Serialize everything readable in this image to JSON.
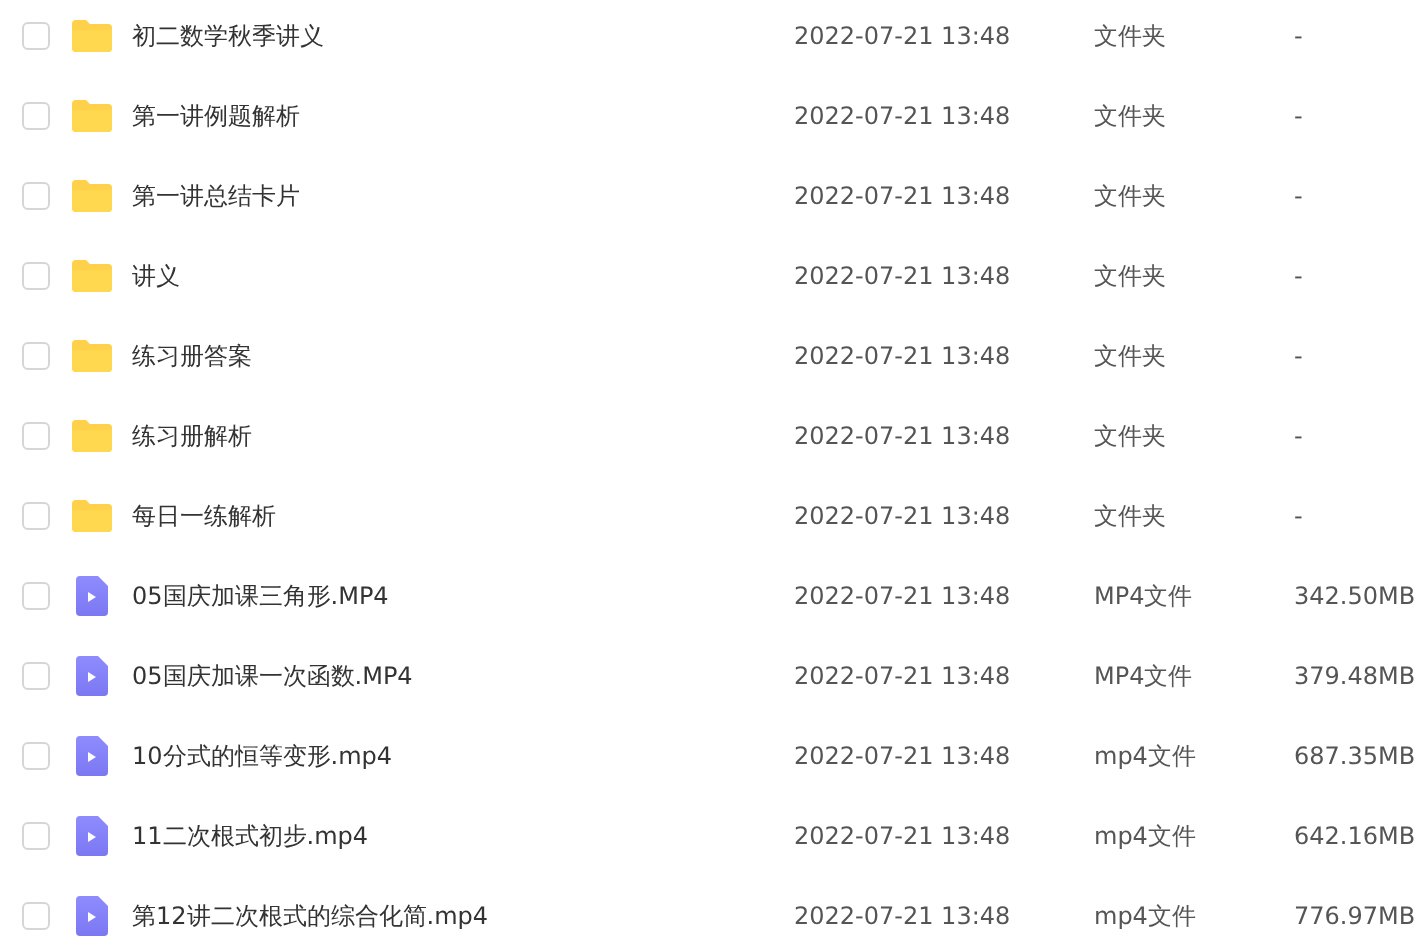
{
  "files": [
    {
      "kind": "folder",
      "checked": false,
      "name": "初二数学秋季讲义",
      "modified": "2022-07-21 13:48",
      "type": "文件夹",
      "size": "-"
    },
    {
      "kind": "folder",
      "checked": false,
      "name": "第一讲例题解析",
      "modified": "2022-07-21 13:48",
      "type": "文件夹",
      "size": "-"
    },
    {
      "kind": "folder",
      "checked": false,
      "name": "第一讲总结卡片",
      "modified": "2022-07-21 13:48",
      "type": "文件夹",
      "size": "-"
    },
    {
      "kind": "folder",
      "checked": false,
      "name": "讲义",
      "modified": "2022-07-21 13:48",
      "type": "文件夹",
      "size": "-"
    },
    {
      "kind": "folder",
      "checked": false,
      "name": "练习册答案",
      "modified": "2022-07-21 13:48",
      "type": "文件夹",
      "size": "-"
    },
    {
      "kind": "folder",
      "checked": false,
      "name": "练习册解析",
      "modified": "2022-07-21 13:48",
      "type": "文件夹",
      "size": "-"
    },
    {
      "kind": "folder",
      "checked": false,
      "name": "每日一练解析",
      "modified": "2022-07-21 13:48",
      "type": "文件夹",
      "size": "-"
    },
    {
      "kind": "video",
      "checked": false,
      "name": "05国庆加课三角形.MP4",
      "modified": "2022-07-21 13:48",
      "type": "MP4文件",
      "size": "342.50MB"
    },
    {
      "kind": "video",
      "checked": false,
      "name": "05国庆加课一次函数.MP4",
      "modified": "2022-07-21 13:48",
      "type": "MP4文件",
      "size": "379.48MB"
    },
    {
      "kind": "video",
      "checked": false,
      "name": "10分式的恒等变形.mp4",
      "modified": "2022-07-21 13:48",
      "type": "mp4文件",
      "size": "687.35MB"
    },
    {
      "kind": "video",
      "checked": false,
      "name": "11二次根式初步.mp4",
      "modified": "2022-07-21 13:48",
      "type": "mp4文件",
      "size": "642.16MB"
    },
    {
      "kind": "video",
      "checked": false,
      "name": "第12讲二次根式的综合化简.mp4",
      "modified": "2022-07-21 13:48",
      "type": "mp4文件",
      "size": "776.97MB"
    }
  ]
}
